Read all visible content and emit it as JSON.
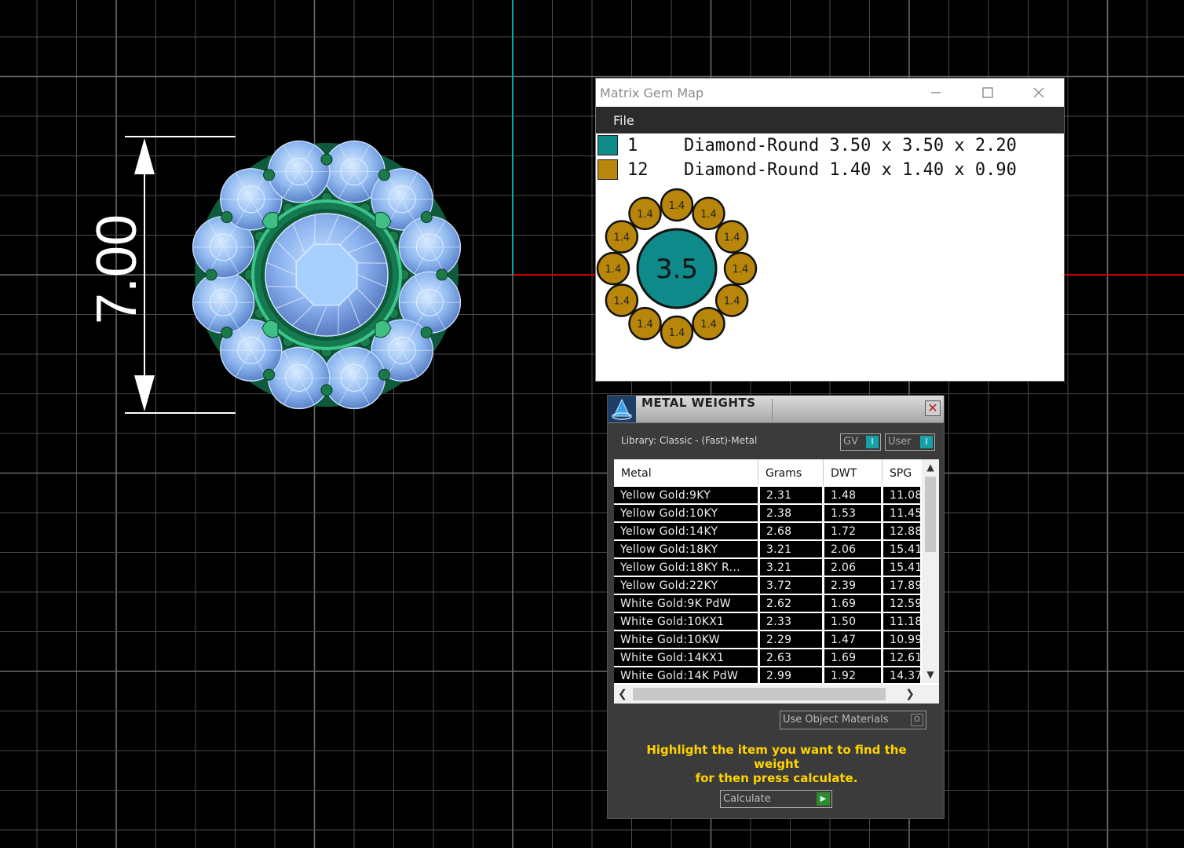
{
  "viewport": {
    "dimension_label": "7.00",
    "axis_colors": {
      "vertical": "#00a8b0",
      "horizontal": "#cc0000"
    },
    "grid_color": "#4a4a4a"
  },
  "gem_map": {
    "title": "Matrix Gem Map",
    "window_controls": {
      "minimize": "minimize-icon",
      "maximize": "maximize-icon",
      "close": "close-icon"
    },
    "menu": {
      "file": "File"
    },
    "gems": [
      {
        "count": "1",
        "description": "Diamond-Round 3.50 x 3.50 x 2.20",
        "color": "#0e8a8a"
      },
      {
        "count": "12",
        "description": "Diamond-Round 1.40 x 1.40 x 0.90",
        "color": "#b8860b"
      }
    ],
    "diagram": {
      "center_label": "3.5",
      "side_label": "1.4",
      "side_count": 12
    }
  },
  "metal_weights": {
    "title": "METAL WEIGHTS",
    "close_label": "✕",
    "library": "Library: Classic - (Fast)-Metal",
    "toggles": {
      "gv": "GV",
      "user": "User"
    },
    "columns": [
      "Metal",
      "Grams",
      "DWT",
      "SPG"
    ],
    "rows": [
      [
        "Yellow Gold:9KY",
        "2.31",
        "1.48",
        "11.08"
      ],
      [
        "Yellow Gold:10KY",
        "2.38",
        "1.53",
        "11.45"
      ],
      [
        "Yellow Gold:14KY",
        "2.68",
        "1.72",
        "12.88"
      ],
      [
        "Yellow Gold:18KY",
        "3.21",
        "2.06",
        "15.41"
      ],
      [
        "Yellow Gold:18KY R...",
        "3.21",
        "2.06",
        "15.41"
      ],
      [
        "Yellow Gold:22KY",
        "3.72",
        "2.39",
        "17.89"
      ],
      [
        "White Gold:9K PdW",
        "2.62",
        "1.69",
        "12.59"
      ],
      [
        "White Gold:10KX1",
        "2.33",
        "1.50",
        "11.18"
      ],
      [
        "White Gold:10KW",
        "2.29",
        "1.47",
        "10.99"
      ],
      [
        "White Gold:14KX1",
        "2.63",
        "1.69",
        "12.61"
      ],
      [
        "White Gold:14K PdW",
        "2.99",
        "1.92",
        "14.37"
      ]
    ],
    "use_object_materials": "Use Object Materials",
    "hint_line1": "Highlight the item you want to find the weight",
    "hint_line2": "for then press calculate.",
    "calculate": "Calculate"
  }
}
